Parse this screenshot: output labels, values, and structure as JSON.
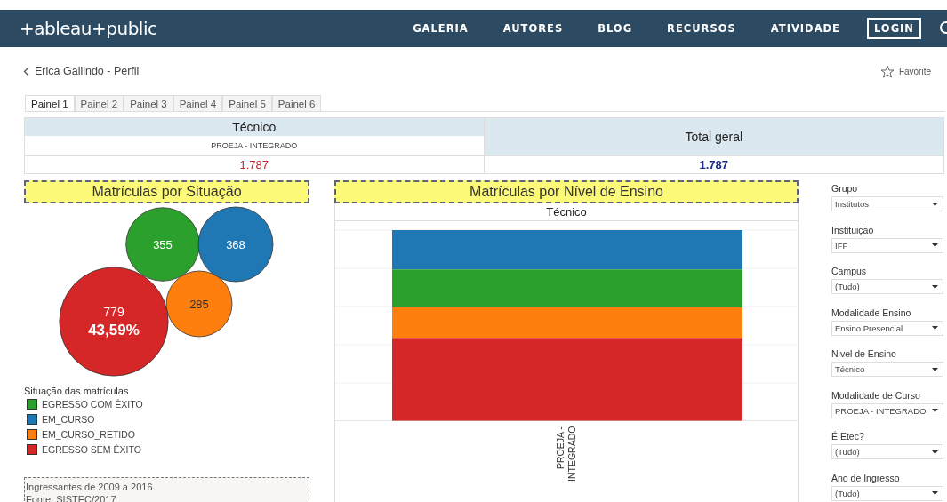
{
  "header": {
    "logo": "+ableau+public",
    "nav": [
      {
        "label": "GALERIA",
        "selected": false
      },
      {
        "label": "AUTORES",
        "selected": false
      },
      {
        "label": "BLOG",
        "selected": false
      },
      {
        "label": "RECURSOS",
        "selected": false
      },
      {
        "label": "ATIVIDADE",
        "selected": false
      }
    ],
    "login": "LOGIN"
  },
  "breadcrumb": "Erica Gallindo - Perfil",
  "favorite": "Favorite",
  "tabs": [
    {
      "label": "Painel 1",
      "selected": true
    },
    {
      "label": "Painel 2",
      "selected": false
    },
    {
      "label": "Painel 3",
      "selected": false
    },
    {
      "label": "Painel 4",
      "selected": false
    },
    {
      "label": "Painel 5",
      "selected": false
    },
    {
      "label": "Painel 6",
      "selected": false
    }
  ],
  "summary": {
    "level_header": "Técnico",
    "modality": "PROEJA - INTEGRADO",
    "value": "1.787",
    "total_header": "Total geral",
    "total_value": "1.787"
  },
  "bubble_panel": {
    "title": "Matrículas por Situação",
    "bubbles": [
      {
        "value": "355",
        "color": "#2ca02c"
      },
      {
        "value": "368",
        "color": "#1f77b4"
      },
      {
        "value": "285",
        "color": "#ff7f0e"
      },
      {
        "value": "779",
        "percent": "43,59%",
        "color": "#d62728"
      }
    ],
    "legend_title": "Situação das matrículas",
    "legend": [
      {
        "label": "EGRESSO COM ÊXITO",
        "color": "#2ca02c"
      },
      {
        "label": "EM_CURSO",
        "color": "#1f77b4"
      },
      {
        "label": "EM_CURSO_RETIDO",
        "color": "#ff7f0e"
      },
      {
        "label": "EGRESSO SEM ÊXITO",
        "color": "#d62728"
      }
    ],
    "notes": [
      "Ingressantes de 2009 a 2016",
      "Fonte: SISTEC/2017"
    ]
  },
  "bar_panel": {
    "title": "Matrículas por Nível de Ensino",
    "column_header": "Técnico",
    "category": "PROEJA - INTEGRADO"
  },
  "filters": [
    {
      "label": "Grupo",
      "value": "Institutos"
    },
    {
      "label": "Instituição",
      "value": "IFF"
    },
    {
      "label": "Campus",
      "value": "(Tudo)"
    },
    {
      "label": "Modalidade Ensino",
      "value": "Ensino Presencial"
    },
    {
      "label": "Nivel de Ensino",
      "value": "Técnico"
    },
    {
      "label": "Modalidade de Curso",
      "value": "PROEJA - INTEGRADO"
    },
    {
      "label": "É Etec?",
      "value": "(Tudo)"
    },
    {
      "label": "Ano de Ingresso",
      "value": "(Tudo)"
    }
  ]
}
